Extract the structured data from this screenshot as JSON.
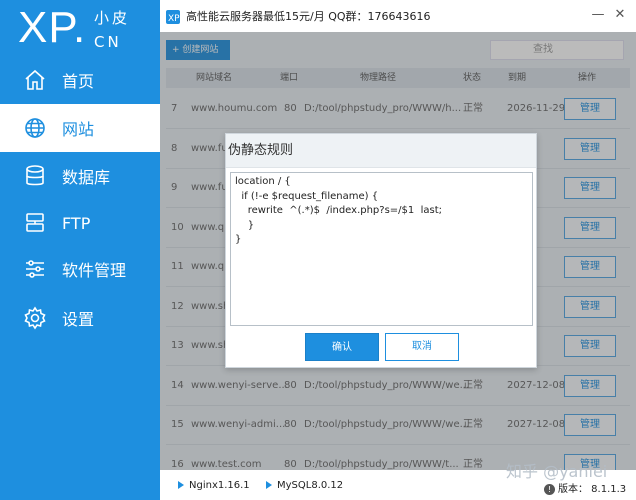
{
  "sidebar": {
    "logo_main": "XP.",
    "logo_cn_top": "小皮",
    "logo_cn_bottom": "CN",
    "items": [
      {
        "label": "首页",
        "icon": "home-icon"
      },
      {
        "label": "网站",
        "icon": "globe-icon",
        "active": true
      },
      {
        "label": "数据库",
        "icon": "database-icon"
      },
      {
        "label": "FTP",
        "icon": "server-icon"
      },
      {
        "label": "软件管理",
        "icon": "sliders-icon"
      },
      {
        "label": "设置",
        "icon": "gear-icon"
      }
    ]
  },
  "titlebar": {
    "title": "高性能云服务器最低15元/月  QQ群：176643616",
    "minimize": "—",
    "close": "✕"
  },
  "toolbar": {
    "create_label": "+  创建网站",
    "search_placeholder": "查找"
  },
  "table": {
    "headers": [
      "网站域名",
      "端口",
      "物理路径",
      "状态",
      "到期",
      "操作"
    ],
    "rows": [
      {
        "id": "7",
        "domain": "www.houmu.com",
        "port": "80",
        "path": "D:/tool/phpstudy_pro/WWW/h...",
        "status": "正常",
        "expiry": "2026-11-29",
        "action": "管理"
      },
      {
        "id": "8",
        "domain": "www.fu",
        "port": "",
        "path": "",
        "status": "",
        "expiry": "",
        "action": "管理"
      },
      {
        "id": "9",
        "domain": "www.fu",
        "port": "",
        "path": "",
        "status": "",
        "expiry": "",
        "action": "管理"
      },
      {
        "id": "10",
        "domain": "www.qin",
        "port": "",
        "path": "",
        "status": "",
        "expiry": "",
        "action": "管理"
      },
      {
        "id": "11",
        "domain": "www.qi",
        "port": "",
        "path": "",
        "status": "",
        "expiry": "",
        "action": "管理"
      },
      {
        "id": "12",
        "domain": "www.sh",
        "port": "",
        "path": "",
        "status": "",
        "expiry": "",
        "action": "管理"
      },
      {
        "id": "13",
        "domain": "www.sh",
        "port": "",
        "path": "",
        "status": "",
        "expiry": "",
        "action": "管理"
      },
      {
        "id": "14",
        "domain": "www.wenyi-serve...",
        "port": "80",
        "path": "D:/tool/phpstudy_pro/WWW/we...",
        "status": "正常",
        "expiry": "2027-12-08",
        "action": "管理"
      },
      {
        "id": "15",
        "domain": "www.wenyi-admi...",
        "port": "80",
        "path": "D:/tool/phpstudy_pro/WWW/we...",
        "status": "正常",
        "expiry": "2027-12-08",
        "action": "管理"
      },
      {
        "id": "16",
        "domain": "www.test.com",
        "port": "80",
        "path": "D:/tool/phpstudy_pro/WWW/t...",
        "status": "正常",
        "expiry": "",
        "action": "管理"
      }
    ]
  },
  "dialog": {
    "title": "伪静态规则",
    "rule_text": "location / {\n  if (!-e $request_filename) {\n    rewrite  ^(.*)$  /index.php?s=/$1  last;\n    }\n}",
    "ok_label": "确认",
    "cancel_label": "取消"
  },
  "statusbar": {
    "nginx": "Nginx1.16.1",
    "mysql": "MySQL8.0.12",
    "version": "版本： 8.1.1.3",
    "watermark": "知乎 @yanlei"
  },
  "colors": {
    "accent": "#1e8fdf",
    "main_bg": "#e9eef3"
  }
}
